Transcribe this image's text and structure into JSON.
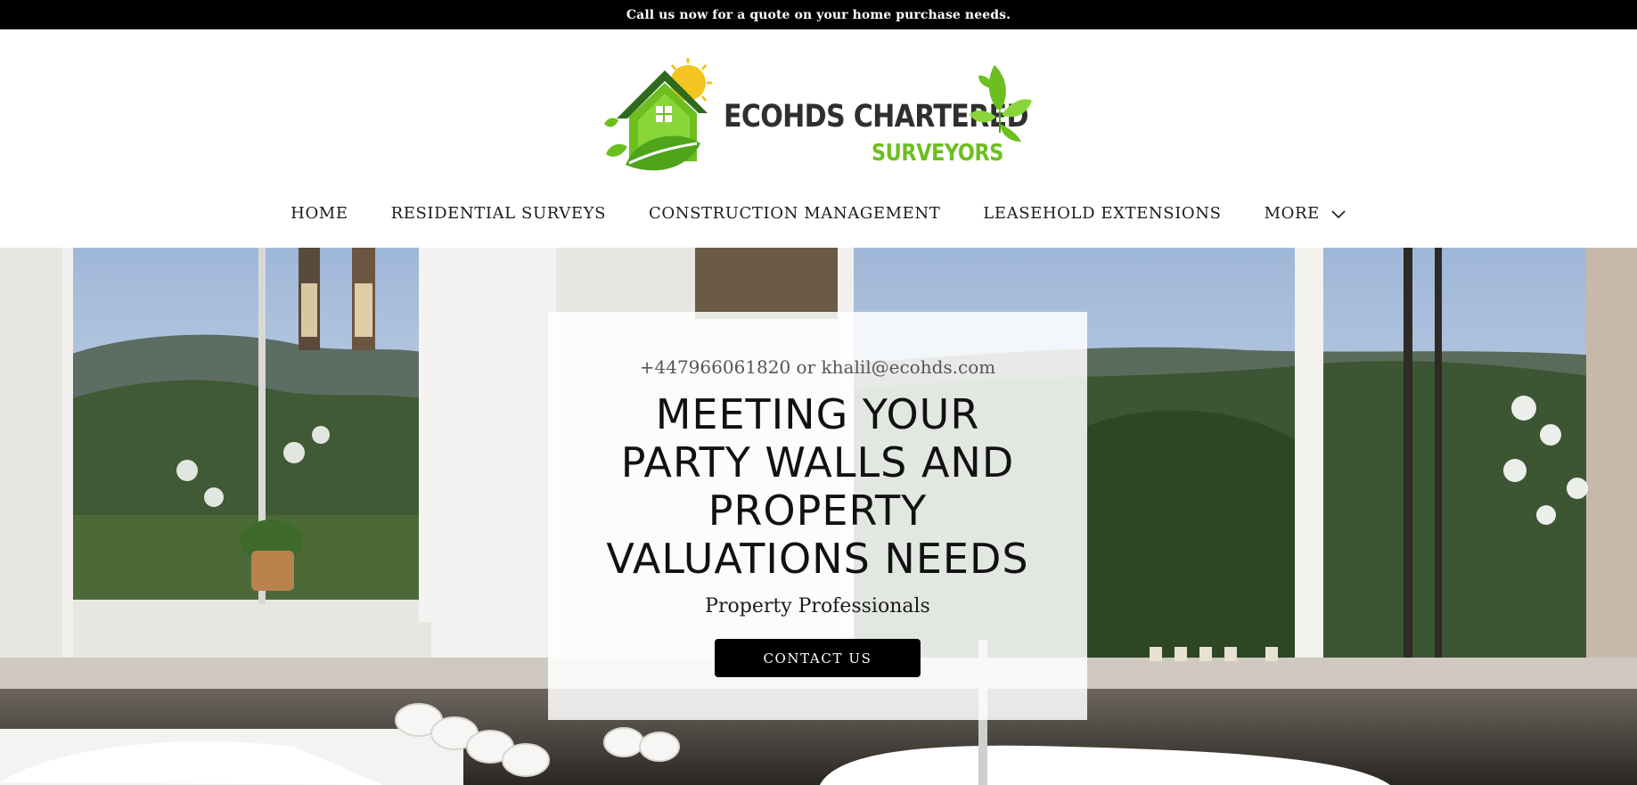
{
  "announcement": {
    "text": "Call us now for a quote on your home purchase needs."
  },
  "brand": {
    "line1": "ECOHDS CHARTERED",
    "line2": "SURVEYORS",
    "colors": {
      "green": "#6cbf1f",
      "dark_green": "#2f6b1c",
      "sun": "#f3c521",
      "text": "#2f2f2f"
    }
  },
  "nav": {
    "items": [
      {
        "label": "HOME"
      },
      {
        "label": "RESIDENTIAL SURVEYS"
      },
      {
        "label": "CONSTRUCTION MANAGEMENT"
      },
      {
        "label": "LEASEHOLD EXTENSIONS"
      },
      {
        "label": "MORE",
        "icon": "chevron-down-icon"
      }
    ]
  },
  "hero": {
    "contact_line": "+447966061820 or khalil@ecohds.com",
    "headline_lines": [
      "MEETING YOUR",
      "PARTY WALLS AND",
      "PROPERTY",
      "VALUATIONS NEEDS"
    ],
    "subtitle": "Property Professionals",
    "cta_label": "CONTACT US",
    "background": "bathroom-with-mountain-view-photo"
  }
}
